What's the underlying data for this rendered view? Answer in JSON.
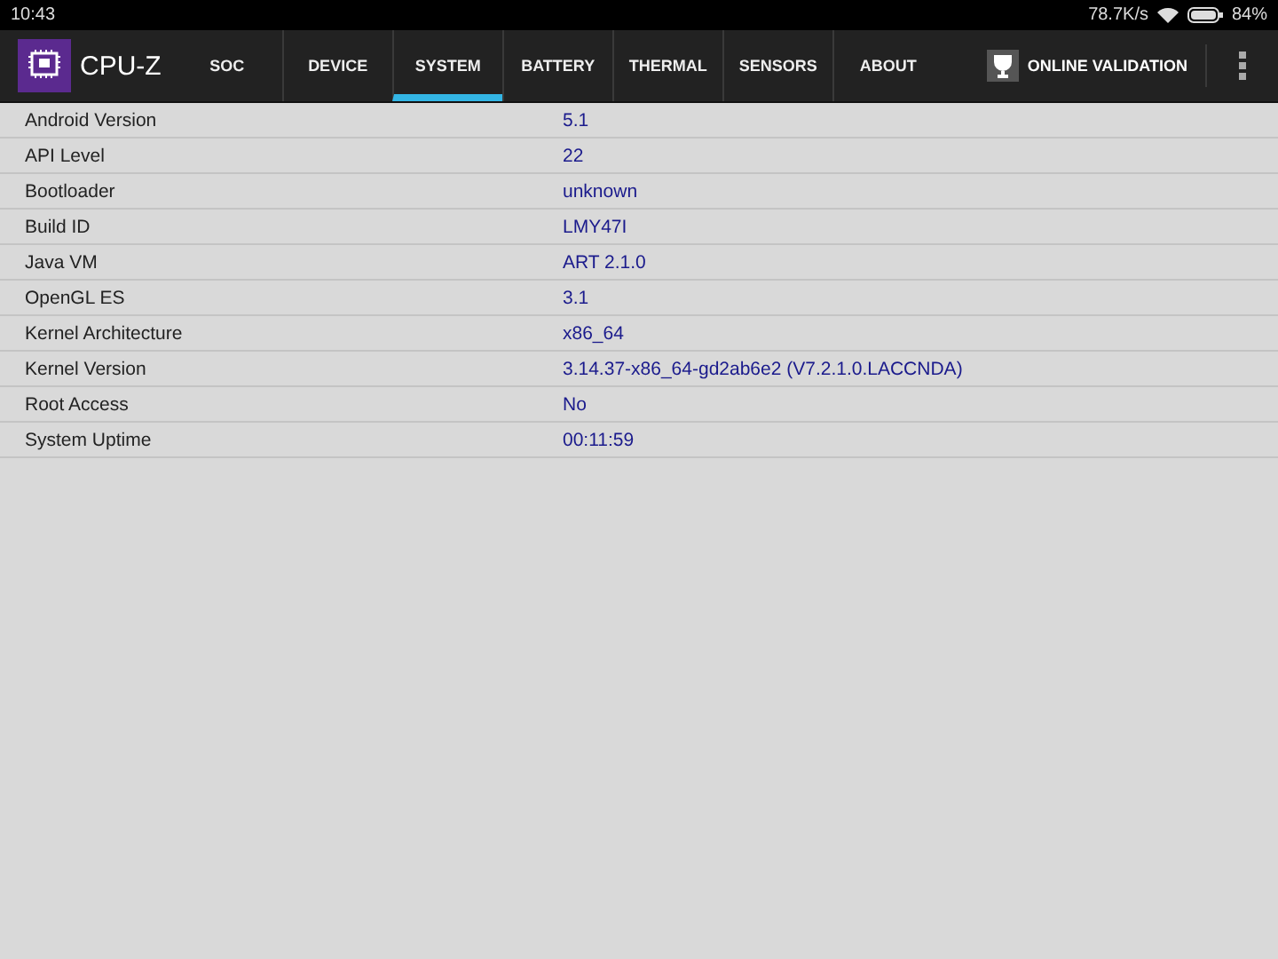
{
  "status_bar": {
    "time": "10:43",
    "network_speed": "78.7K/s",
    "battery": "84%"
  },
  "app_bar": {
    "title": "CPU-Z",
    "validation_button": "ONLINE VALIDATION"
  },
  "tabs": [
    {
      "label": "SOC",
      "selected": false
    },
    {
      "label": "DEVICE",
      "selected": false
    },
    {
      "label": "SYSTEM",
      "selected": true
    },
    {
      "label": "BATTERY",
      "selected": false
    },
    {
      "label": "THERMAL",
      "selected": false
    },
    {
      "label": "SENSORS",
      "selected": false
    },
    {
      "label": "ABOUT",
      "selected": false
    }
  ],
  "rows": [
    {
      "label": "Android Version",
      "value": "5.1"
    },
    {
      "label": "API Level",
      "value": "22"
    },
    {
      "label": "Bootloader",
      "value": "unknown"
    },
    {
      "label": "Build ID",
      "value": "LMY47I"
    },
    {
      "label": "Java VM",
      "value": "ART 2.1.0"
    },
    {
      "label": "OpenGL ES",
      "value": "3.1"
    },
    {
      "label": "Kernel Architecture",
      "value": "x86_64"
    },
    {
      "label": "Kernel Version",
      "value": "3.14.37-x86_64-gd2ab6e2 (V7.2.1.0.LACCNDA)"
    },
    {
      "label": "Root Access",
      "value": "No"
    },
    {
      "label": "System Uptime",
      "value": "00:11:59"
    }
  ]
}
